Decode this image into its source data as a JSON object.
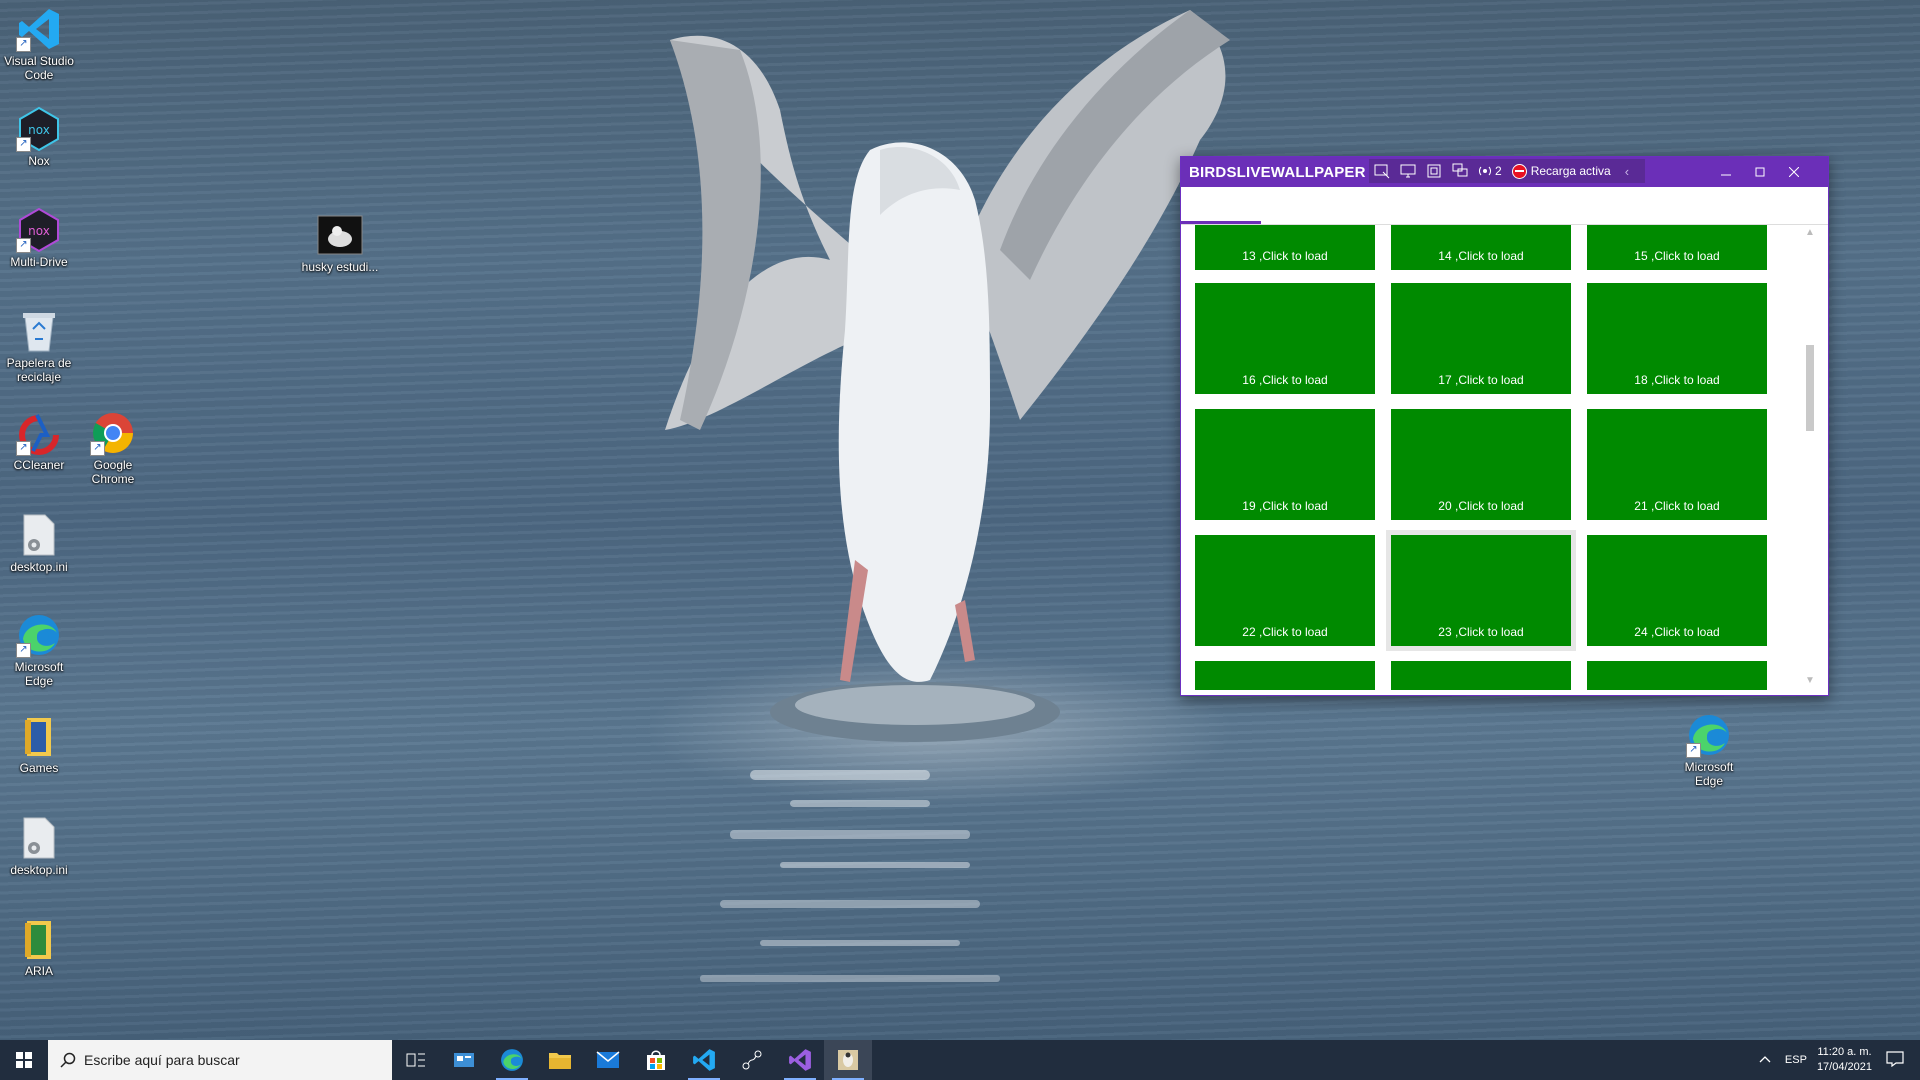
{
  "desktop_icons": [
    {
      "label": "Visual Studio Code",
      "icon": "vscode-icon"
    },
    {
      "label": "Nox",
      "icon": "nox-icon"
    },
    {
      "label": "Multi-Drive",
      "icon": "nox-multidrive-icon"
    },
    {
      "label": "Papelera de reciclaje",
      "icon": "recycle-bin-icon"
    },
    {
      "label": "CCleaner",
      "icon": "ccleaner-icon"
    },
    {
      "label": "Google Chrome",
      "icon": "chrome-icon"
    },
    {
      "label": "desktop.ini",
      "icon": "settings-file-icon"
    },
    {
      "label": "Microsoft Edge",
      "icon": "edge-icon"
    },
    {
      "label": "Games",
      "icon": "folder-icon"
    },
    {
      "label": "desktop.ini",
      "icon": "settings-file-icon"
    },
    {
      "label": "ARIA",
      "icon": "folder-icon"
    },
    {
      "label": "husky estudi...",
      "icon": "image-file-icon"
    },
    {
      "label": "Microsoft Edge",
      "icon": "edge-icon"
    }
  ],
  "window": {
    "title": "BIRDSLIVEWALLPAPER",
    "counter": "2",
    "recarga_label": "Recarga activa",
    "title_color": "#6b2fb8"
  },
  "tiles": [
    "13 ,Click to load",
    "14 ,Click to load",
    "15 ,Click to load",
    "16 ,Click to load",
    "17 ,Click to load",
    "18 ,Click to load",
    "19 ,Click to load",
    "20 ,Click to load",
    "21 ,Click to load",
    "22 ,Click to load",
    "23 ,Click to load",
    "24 ,Click to load",
    "",
    "",
    ""
  ],
  "tile_color": "#008a00",
  "taskbar": {
    "search_placeholder": "Escribe aquí para buscar",
    "apps": [
      "task-view-icon",
      "control-panel-icon",
      "edge-icon",
      "file-explorer-icon",
      "mail-icon",
      "store-icon",
      "vscode-icon",
      "network-icon",
      "visual-studio-icon",
      "birds-wallpaper-app-icon"
    ],
    "language": "ESP",
    "time": "11:20 a. m.",
    "date": "17/04/2021"
  }
}
